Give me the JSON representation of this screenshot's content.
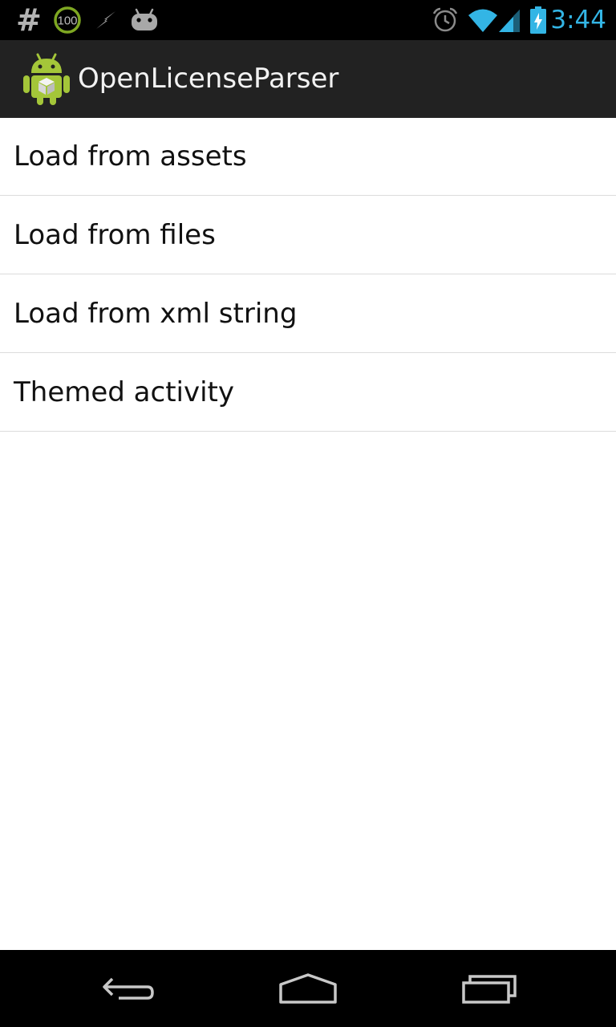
{
  "status_bar": {
    "battery_badge": "100",
    "time": "3:44",
    "time_color": "#33b5e5",
    "icons": [
      "hash-icon",
      "battery-100-icon",
      "flash-icon",
      "android-debug-icon",
      "alarm-icon",
      "wifi-icon",
      "signal-icon",
      "battery-charging-icon"
    ]
  },
  "action_bar": {
    "title": "OpenLicenseParser",
    "icon": "android-app-icon"
  },
  "list": {
    "items": [
      {
        "label": "Load from assets"
      },
      {
        "label": "Load from files"
      },
      {
        "label": "Load from xml string"
      },
      {
        "label": "Themed activity"
      }
    ]
  },
  "nav_bar": {
    "icons": [
      "back-icon",
      "home-icon",
      "recents-icon"
    ]
  }
}
